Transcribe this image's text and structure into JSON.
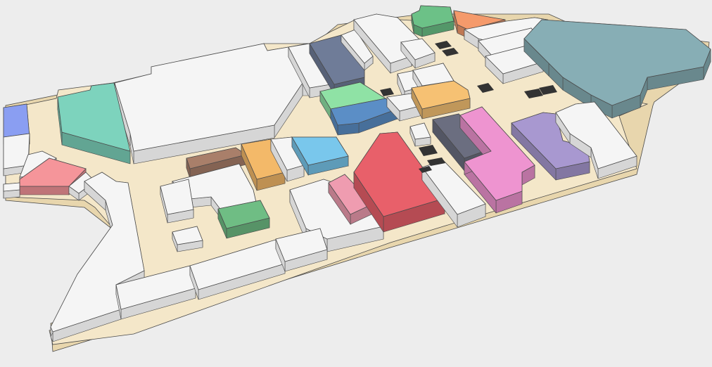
{
  "map": {
    "view": "isometric-3d",
    "kind": "shopping-mall-floor-plan",
    "labels_visible": false
  },
  "colors": {
    "background": "#ededed",
    "floor": "#f4e7c9",
    "floor_edge": "#e8d6ad",
    "neutral_unit": "#f5f5f5",
    "neutral_side": "#d6d6d6",
    "outline": "#4a4a4a",
    "escalator": "#333333"
  },
  "units": [
    {
      "id": "unit-blue-left",
      "color": "#8a9ef2"
    },
    {
      "id": "unit-teal-left",
      "color": "#7dd3bd"
    },
    {
      "id": "unit-red-left",
      "color": "#f5959a"
    },
    {
      "id": "unit-navy-top",
      "color": "#6f7c98"
    },
    {
      "id": "unit-green-top",
      "color": "#6cc187"
    },
    {
      "id": "unit-orange-top",
      "color": "#f59a6b"
    },
    {
      "id": "unit-slate-big",
      "color": "#87aeb5"
    },
    {
      "id": "unit-mint-center",
      "color": "#8fe2a5"
    },
    {
      "id": "unit-blue-center",
      "color": "#5b8ec6"
    },
    {
      "id": "unit-yellow-center",
      "color": "#f6c173"
    },
    {
      "id": "unit-brown",
      "color": "#a97f6a"
    },
    {
      "id": "unit-yellow-left",
      "color": "#f3b969"
    },
    {
      "id": "unit-sky",
      "color": "#79c7ec"
    },
    {
      "id": "unit-green-bottom",
      "color": "#6fbd84"
    },
    {
      "id": "unit-pink-light",
      "color": "#ef9cb0"
    },
    {
      "id": "unit-red-big",
      "color": "#e8606a"
    },
    {
      "id": "unit-charcoal",
      "color": "#6b6e80"
    },
    {
      "id": "unit-pink",
      "color": "#ee94d0"
    },
    {
      "id": "unit-purple",
      "color": "#a898d0"
    }
  ],
  "escalators_count": 9
}
